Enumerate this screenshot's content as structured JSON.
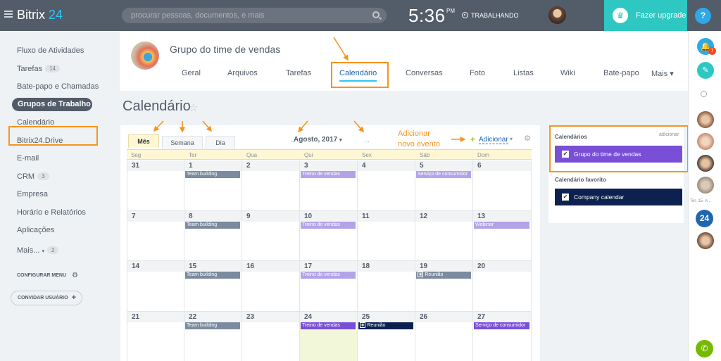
{
  "topbar": {
    "logo_text": "Bitrix",
    "logo_num": " 24",
    "search_placeholder": "procurar pessoas, documentos, e mais",
    "clock": "5:36",
    "clock_ampm": "PM",
    "work_status": "TRABALHANDO",
    "upgrade_label": "Fazer upgrade",
    "help_label": "?"
  },
  "leftnav": {
    "items": [
      {
        "label": "Fluxo de Atividades"
      },
      {
        "label": "Tarefas",
        "count": "14"
      },
      {
        "label": "Bate-papo e Chamadas"
      },
      {
        "label": "Grupos de Trabalho",
        "active": true
      },
      {
        "label": "Calendário"
      },
      {
        "label": "Bitrix24.Drive"
      },
      {
        "label": "E-mail"
      },
      {
        "label": "CRM",
        "count": "3"
      },
      {
        "label": "Empresa"
      },
      {
        "label": "Horário e Relatórios"
      },
      {
        "label": "Aplicações"
      },
      {
        "label": "Mais...",
        "count": "2"
      }
    ],
    "config_label": "CONFIGURAR MENU",
    "invite_label": "CONVIDAR USUÁRIO"
  },
  "group": {
    "title": "Grupo do time de vendas",
    "tabs": [
      "Geral",
      "Arquivos",
      "Tarefas",
      "Calendário",
      "Conversas",
      "Foto",
      "Listas",
      "Wiki",
      "Bate-papo",
      "Mais ▾"
    ],
    "active_tab": "Calendário"
  },
  "page": {
    "title": "Calendário",
    "star": "☆"
  },
  "calendar": {
    "view_tabs": [
      "Mês",
      "Semana",
      "Dia"
    ],
    "active_view": "Mês",
    "month_title": "Agosto, 2017",
    "month_caret": "▾",
    "prev_arrow": "←",
    "next_arrow": "→",
    "add_label": "Adicionar",
    "add_caret": "▾",
    "day_names": [
      "Seg",
      "Ter",
      "Qua",
      "Qui",
      "Sex",
      "Sáb",
      "Dom"
    ],
    "weeks": [
      [
        {
          "day": "31"
        },
        {
          "day": "1",
          "event": {
            "title": "Team building",
            "color": "#7b8a9e"
          }
        },
        {
          "day": "2"
        },
        {
          "day": "3",
          "event": {
            "title": "Treino de vendas",
            "color": "#b3a3e6"
          }
        },
        {
          "day": "4"
        },
        {
          "day": "5",
          "event": {
            "title": "Serviço de consumidor",
            "color": "#b3a3e6"
          }
        },
        {
          "day": "6"
        }
      ],
      [
        {
          "day": "7"
        },
        {
          "day": "8",
          "event": {
            "title": "Team building",
            "color": "#7b8a9e"
          }
        },
        {
          "day": "9"
        },
        {
          "day": "10",
          "event": {
            "title": "Treino de vendas",
            "color": "#b3a3e6"
          }
        },
        {
          "day": "11"
        },
        {
          "day": "12"
        },
        {
          "day": "13",
          "event": {
            "title": "Webinar",
            "color": "#b3a3e6"
          }
        }
      ],
      [
        {
          "day": "14"
        },
        {
          "day": "15",
          "event": {
            "title": "Team building",
            "color": "#7b8a9e"
          }
        },
        {
          "day": "16"
        },
        {
          "day": "17",
          "event": {
            "title": "Treino de vendas",
            "color": "#b3a3e6"
          }
        },
        {
          "day": "18"
        },
        {
          "day": "19",
          "event": {
            "title": "Reunião",
            "color": "#7b8a9e",
            "mark": "O"
          }
        },
        {
          "day": "20"
        }
      ],
      [
        {
          "day": "21"
        },
        {
          "day": "22",
          "event": {
            "title": "Team building",
            "color": "#7b8a9e"
          }
        },
        {
          "day": "23"
        },
        {
          "day": "24",
          "today": true,
          "event": {
            "title": "Treino de vendas",
            "color": "#7a4fd8"
          }
        },
        {
          "day": "25",
          "event": {
            "title": "Reunião",
            "color": "#0c2150",
            "mark": "O"
          }
        },
        {
          "day": "26"
        },
        {
          "day": "27",
          "event": {
            "title": "Serviço de consumidor",
            "color": "#7a4fd8"
          }
        }
      ]
    ]
  },
  "sidebar": {
    "calendars_heading": "Calendários",
    "add_link": "adicionar",
    "calendars": [
      {
        "label": "Grupo do time de vendas",
        "color": "#7a4fd8"
      }
    ],
    "favorite_heading": "Calendário favorito",
    "favorites": [
      {
        "label": "Company calendar",
        "color": "#0c2150"
      }
    ]
  },
  "rail": {
    "badge_count": "7",
    "date_label": "Ter, 15. A...",
    "b24_label": "24"
  },
  "annotation": {
    "line1": "Adicionar",
    "line2": "novo evento",
    "color": "#f7931e"
  },
  "icons": [
    "hamburger-icon",
    "search-icon",
    "clock-status-icon",
    "crown-icon",
    "gear-icon",
    "plus-icon",
    "star-icon",
    "bell-icon",
    "chat-icon",
    "phone-icon"
  ]
}
